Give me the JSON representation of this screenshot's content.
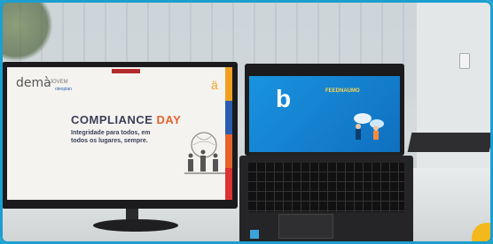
{
  "monitor": {
    "brand": "demà",
    "brand_sub": "JOVEM",
    "brand_tag": "oleoplan",
    "top_badge": "",
    "title_part1": "COMPLIANCE",
    "title_part2": "DAY",
    "subtitle": "Integridade para todos, em todos os lugares, sempre.",
    "footer": "",
    "stripe_colors": [
      "#f0a020",
      "#e5632c",
      "#2a5db0",
      "#d33"
    ]
  },
  "laptop": {
    "logo_letter": "b",
    "title": "FEEDNAUMO",
    "subtitle": "",
    "small_text": "",
    "screen_color": "#1a94e0"
  },
  "colors": {
    "accent_frame": "#1a9fd0",
    "corner": "#f2b81c"
  }
}
